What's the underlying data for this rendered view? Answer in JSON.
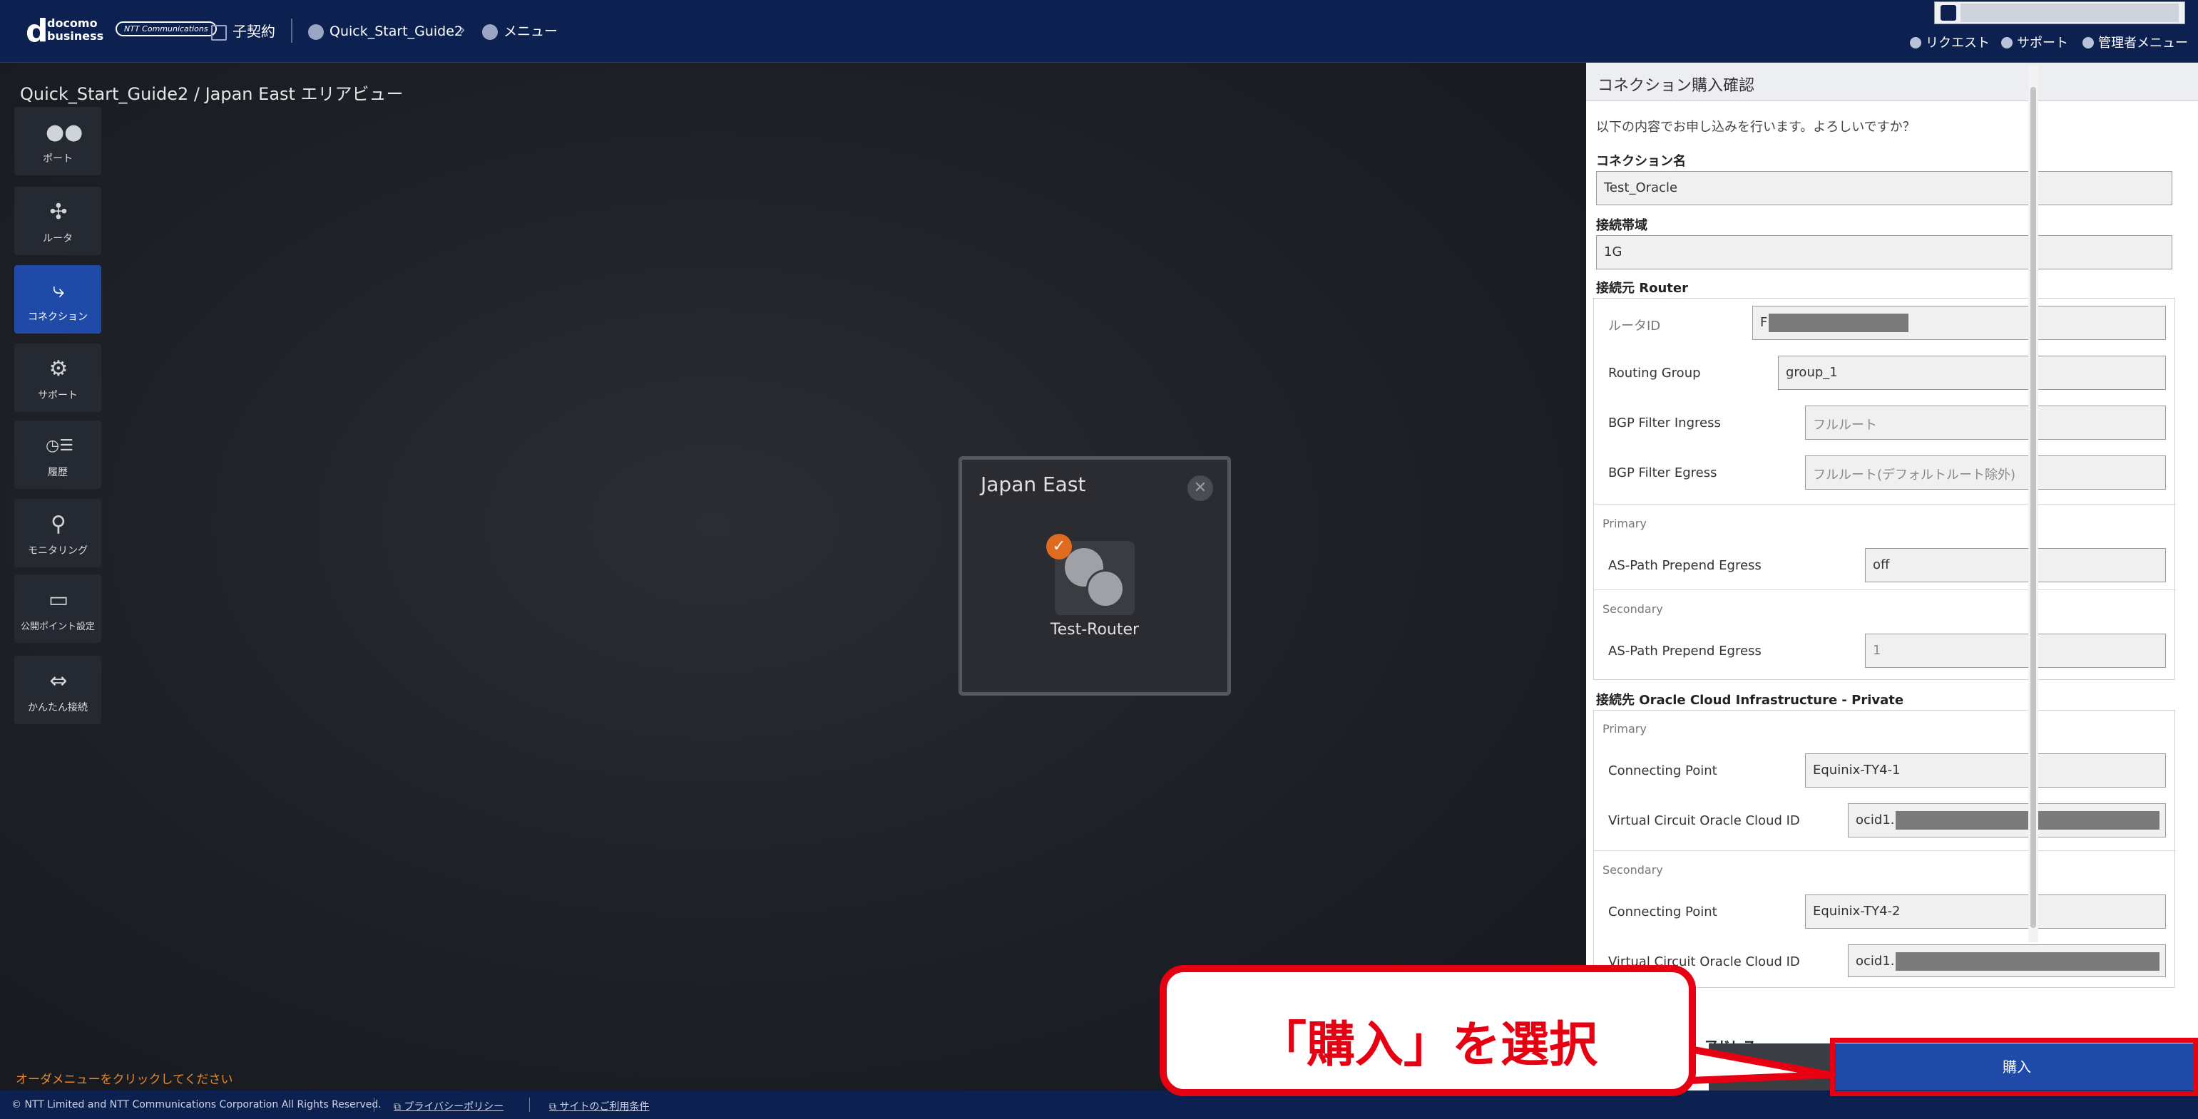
{
  "header": {
    "brand_line1": "docomo",
    "brand_line2": "business",
    "ntt_logo": "NTT Communications",
    "contract": "子契約",
    "project": "Quick_Start_Guide2",
    "menu": "メニュー",
    "links": {
      "request": "リクエスト",
      "support": "サポート",
      "admin": "管理者メニュー"
    }
  },
  "page_title": "Quick_Start_Guide2 / Japan East エリアビュー",
  "sidebar": {
    "items": [
      {
        "label": "ポート",
        "icon": "port-icon"
      },
      {
        "label": "ルータ",
        "icon": "router-icon"
      },
      {
        "label": "コネクション",
        "icon": "connection-icon",
        "active": true
      },
      {
        "label": "サポート",
        "icon": "support-icon"
      },
      {
        "label": "履歴",
        "icon": "history-icon"
      },
      {
        "label": "モニタリング",
        "icon": "monitoring-icon"
      },
      {
        "label": "公開ポイント設定",
        "icon": "public-point-icon"
      },
      {
        "label": "かんたん接続",
        "icon": "easy-connect-icon"
      }
    ]
  },
  "region": {
    "title": "Japan East",
    "router_label": "Test-Router"
  },
  "order_hint": "オーダメニューをクリックしてください",
  "footer": {
    "copyright": "© NTT Limited and NTT Communications Corporation All Rights Reserved.",
    "privacy": "プライバシーポリシー",
    "terms": "サイトのご利用条件"
  },
  "panel": {
    "title": "コネクション購入確認",
    "message": "以下の内容でお申し込みを行います。よろしいですか？",
    "connection_name_label": "コネクション名",
    "connection_name": "Test_Oracle",
    "bandwidth_label": "接続帯域",
    "bandwidth": "1G",
    "source_label": "接続元 Router",
    "router_id_label": "ルータID",
    "router_id_prefix": "F",
    "routing_group_label": "Routing Group",
    "routing_group": "group_1",
    "bgp_ingress_label": "BGP Filter Ingress",
    "bgp_ingress": "フルルート",
    "bgp_egress_label": "BGP Filter Egress",
    "bgp_egress": "フルルート(デフォルトルート除外)",
    "primary": "Primary",
    "secondary": "Secondary",
    "as_path_label": "AS-Path Prepend Egress",
    "as_path_primary": "off",
    "as_path_secondary": "1",
    "dest_label": "接続先 Oracle Cloud Infrastructure - Private",
    "connecting_point_label": "Connecting Point",
    "cp_primary": "Equinix-TY4-1",
    "cp_secondary": "Equinix-TY4-2",
    "vc_label": "Virtual Circuit Oracle Cloud ID",
    "vc_prefix": "ocid1.",
    "partial_label": "アドレス",
    "buy_button": "購入"
  },
  "callout": "「購入」を選択",
  "colors": {
    "accent": "#1f4aa8",
    "header": "#0d2150",
    "highlight": "#e60012",
    "warning": "#e78a2e"
  }
}
